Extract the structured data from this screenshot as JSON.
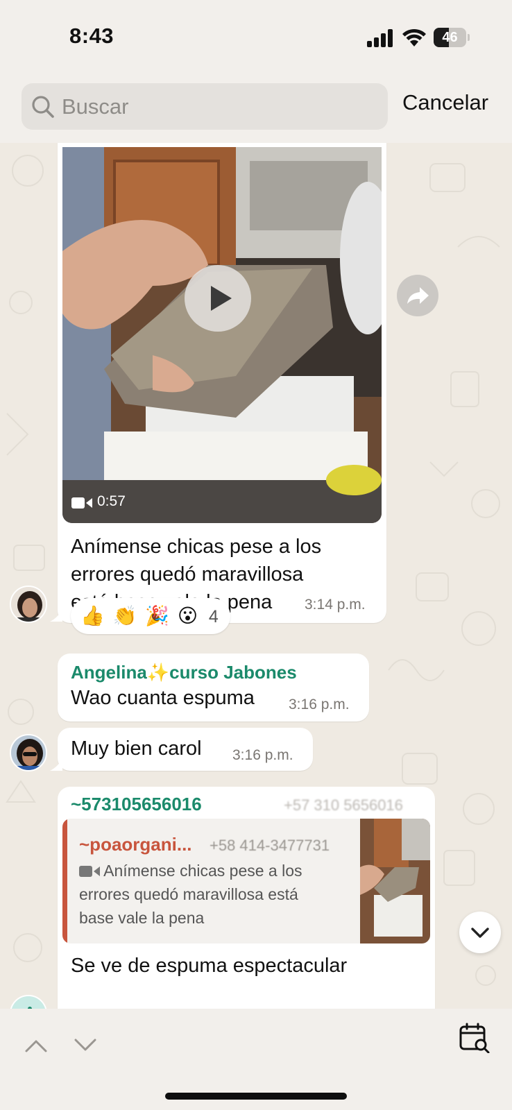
{
  "status_bar": {
    "time": "8:43",
    "battery": "46",
    "battery_level": 0.46
  },
  "search": {
    "placeholder": "Buscar",
    "value": "",
    "cancel_label": "Cancelar"
  },
  "messages": {
    "video": {
      "duration": "0:57",
      "caption_line1": "Anímense chicas pese a los",
      "caption_line2": "errores quedó maravillosa",
      "caption_line3": "está base vale la pena",
      "time": "3:14 p.m.",
      "reactions": "👍 👏 🎉 😮",
      "reaction_count": "4"
    },
    "angelina": {
      "sender": "Angelina✨curso Jabones",
      "sender_color": "#1b8a6b",
      "text": "Wao cuanta espuma",
      "time": "3:16 p.m."
    },
    "carol": {
      "text": "Muy bien carol",
      "time": "3:16 p.m."
    },
    "reply": {
      "sender": "~573105656016",
      "sender_phone": "+57 310 5656016",
      "sender_color": "#1b8a6b",
      "quote_sender": "~poaorgani...",
      "quote_phone": "+58 414-3477731",
      "quote_color": "#c8553d",
      "quote_line1": "Anímense chicas pese a los",
      "quote_line2": "errores quedó maravillosa está",
      "quote_line3": "base vale la pena",
      "text": "Se ve de espuma espectacular"
    }
  }
}
